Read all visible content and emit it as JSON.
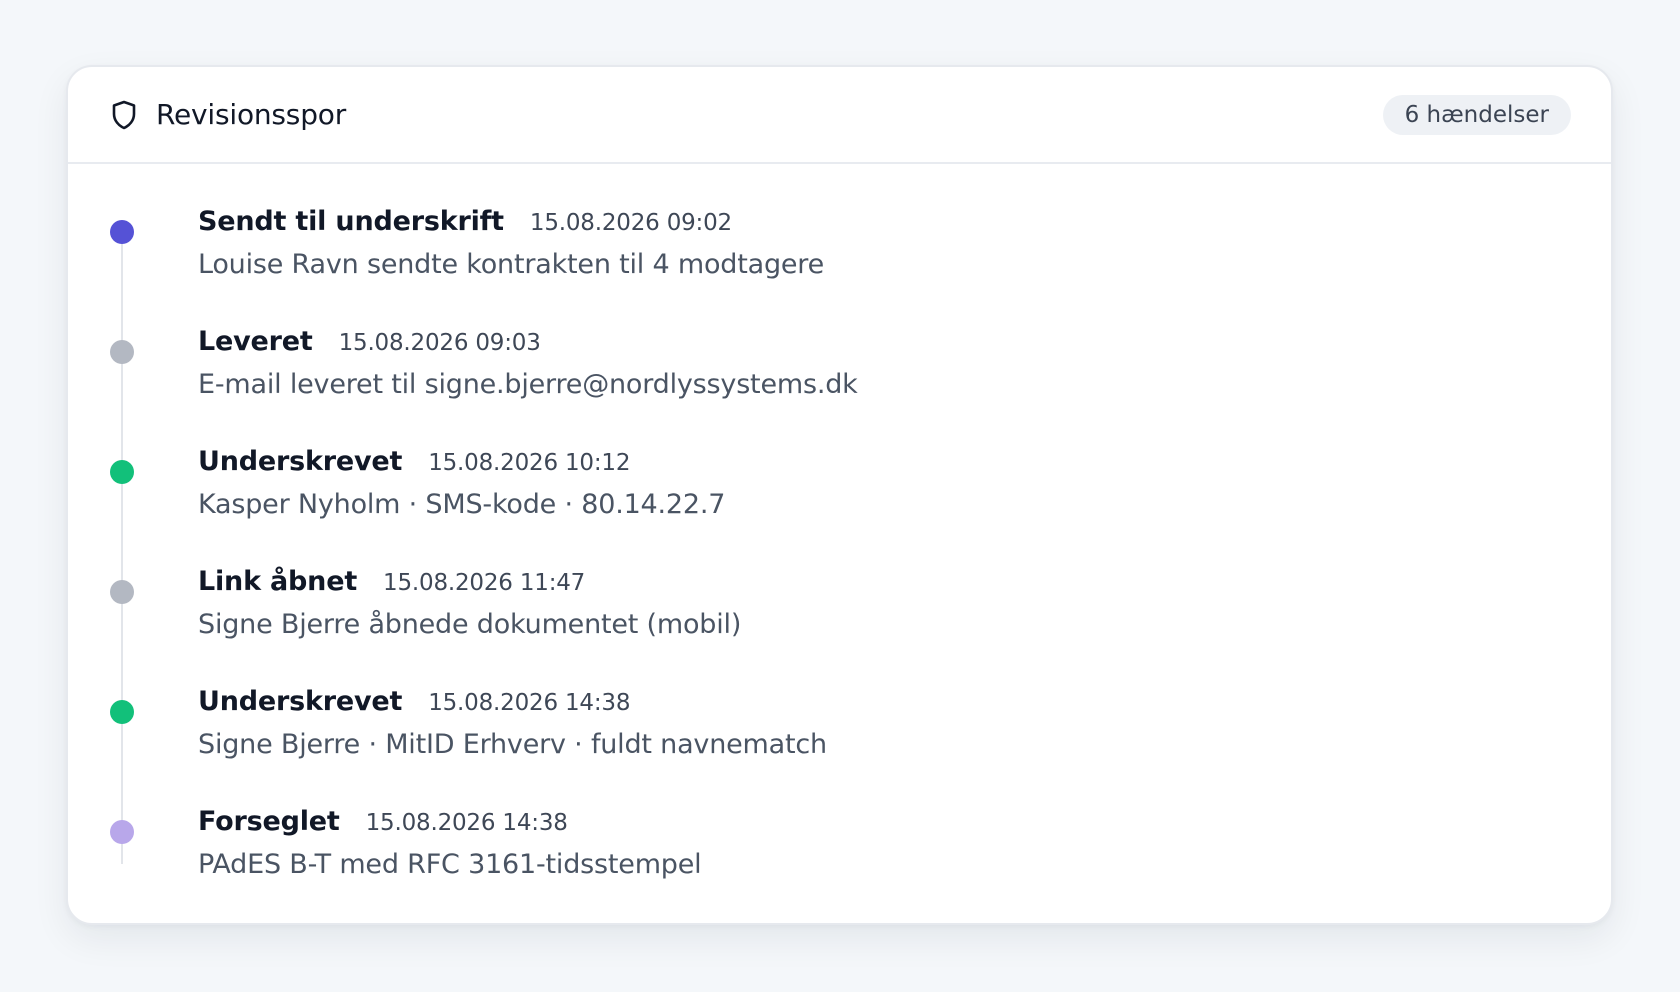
{
  "header": {
    "title": "Revisionsspor",
    "icon": "shield-icon",
    "badge": "6 hændelser"
  },
  "events": [
    {
      "title": "Sendt til underskrift",
      "time": "15.08.2026 09:02",
      "description": "Louise Ravn sendte kontrakten til 4 modtagere",
      "color": "#5552d6"
    },
    {
      "title": "Leveret",
      "time": "15.08.2026 09:03",
      "description": "E-mail leveret til signe.bjerre@nordlyssystems.dk",
      "color": "#b3b8c2"
    },
    {
      "title": "Underskrevet",
      "time": "15.08.2026 10:12",
      "description": "Kasper Nyholm · SMS-kode · 80.14.22.7",
      "color": "#12c07a"
    },
    {
      "title": "Link åbnet",
      "time": "15.08.2026 11:47",
      "description": "Signe Bjerre åbnede dokumentet (mobil)",
      "color": "#b3b8c2"
    },
    {
      "title": "Underskrevet",
      "time": "15.08.2026 14:38",
      "description": "Signe Bjerre · MitID Erhverv · fuldt navnematch",
      "color": "#12c07a"
    },
    {
      "title": "Forseglet",
      "time": "15.08.2026 14:38",
      "description": "PAdES B-T med RFC 3161-tidsstempel",
      "color": "#b8a7ea"
    }
  ]
}
